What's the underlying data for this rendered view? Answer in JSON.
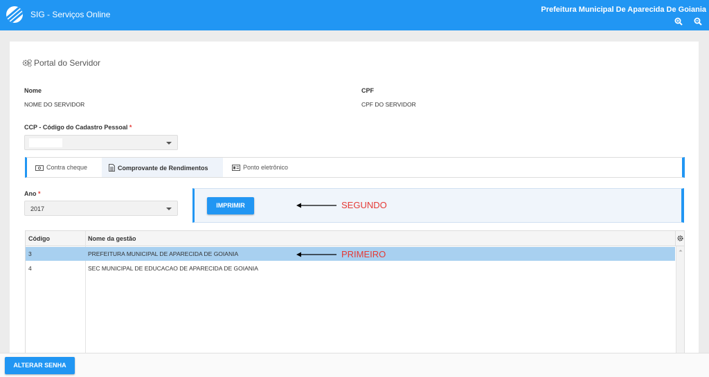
{
  "header": {
    "app_title": "SIG - Serviços Online",
    "org_name": "Prefeitura Municipal De Aparecida De Goiania",
    "zoom_in_icon": "zoom-in-icon",
    "zoom_out_icon": "zoom-out-icon"
  },
  "portal": {
    "title": "Portal do Servidor",
    "icon": "gears-icon"
  },
  "fields": {
    "nome_label": "Nome",
    "nome_value": "NOME DO SERVIDOR",
    "cpf_label": "CPF",
    "cpf_value": "CPF DO SERVIDOR",
    "ccp_label": "CCP - Código do Cadastro Pessoal",
    "required_mark": "*",
    "ccp_value": "",
    "ano_label": "Ano",
    "ano_value": "2017"
  },
  "tabs": [
    {
      "label": "Contra cheque",
      "icon": "money-icon",
      "active": false
    },
    {
      "label": "Comprovante de Rendimentos",
      "icon": "document-icon",
      "active": true
    },
    {
      "label": "Ponto eletrônico",
      "icon": "id-card-icon",
      "active": false
    }
  ],
  "print_button": "IMPRIMIR",
  "annotations": {
    "segundo": "SEGUNDO",
    "primeiro": "PRIMEIRO"
  },
  "grid": {
    "columns": [
      "Código",
      "Nome da gestão"
    ],
    "rows": [
      {
        "codigo": "3",
        "nome": "PREFEITURA MUNICIPAL DE APARECIDA DE GOIANIA",
        "selected": true
      },
      {
        "codigo": "4",
        "nome": "SEC MUNICIPAL DE EDUCACAO DE APARECIDA DE GOIANIA",
        "selected": false
      }
    ]
  },
  "footer": {
    "change_password_button": "ALTERAR SENHA"
  },
  "colors": {
    "primary": "#2196f3",
    "selected_row": "#a8d0f0",
    "annotation": "#e53935"
  }
}
